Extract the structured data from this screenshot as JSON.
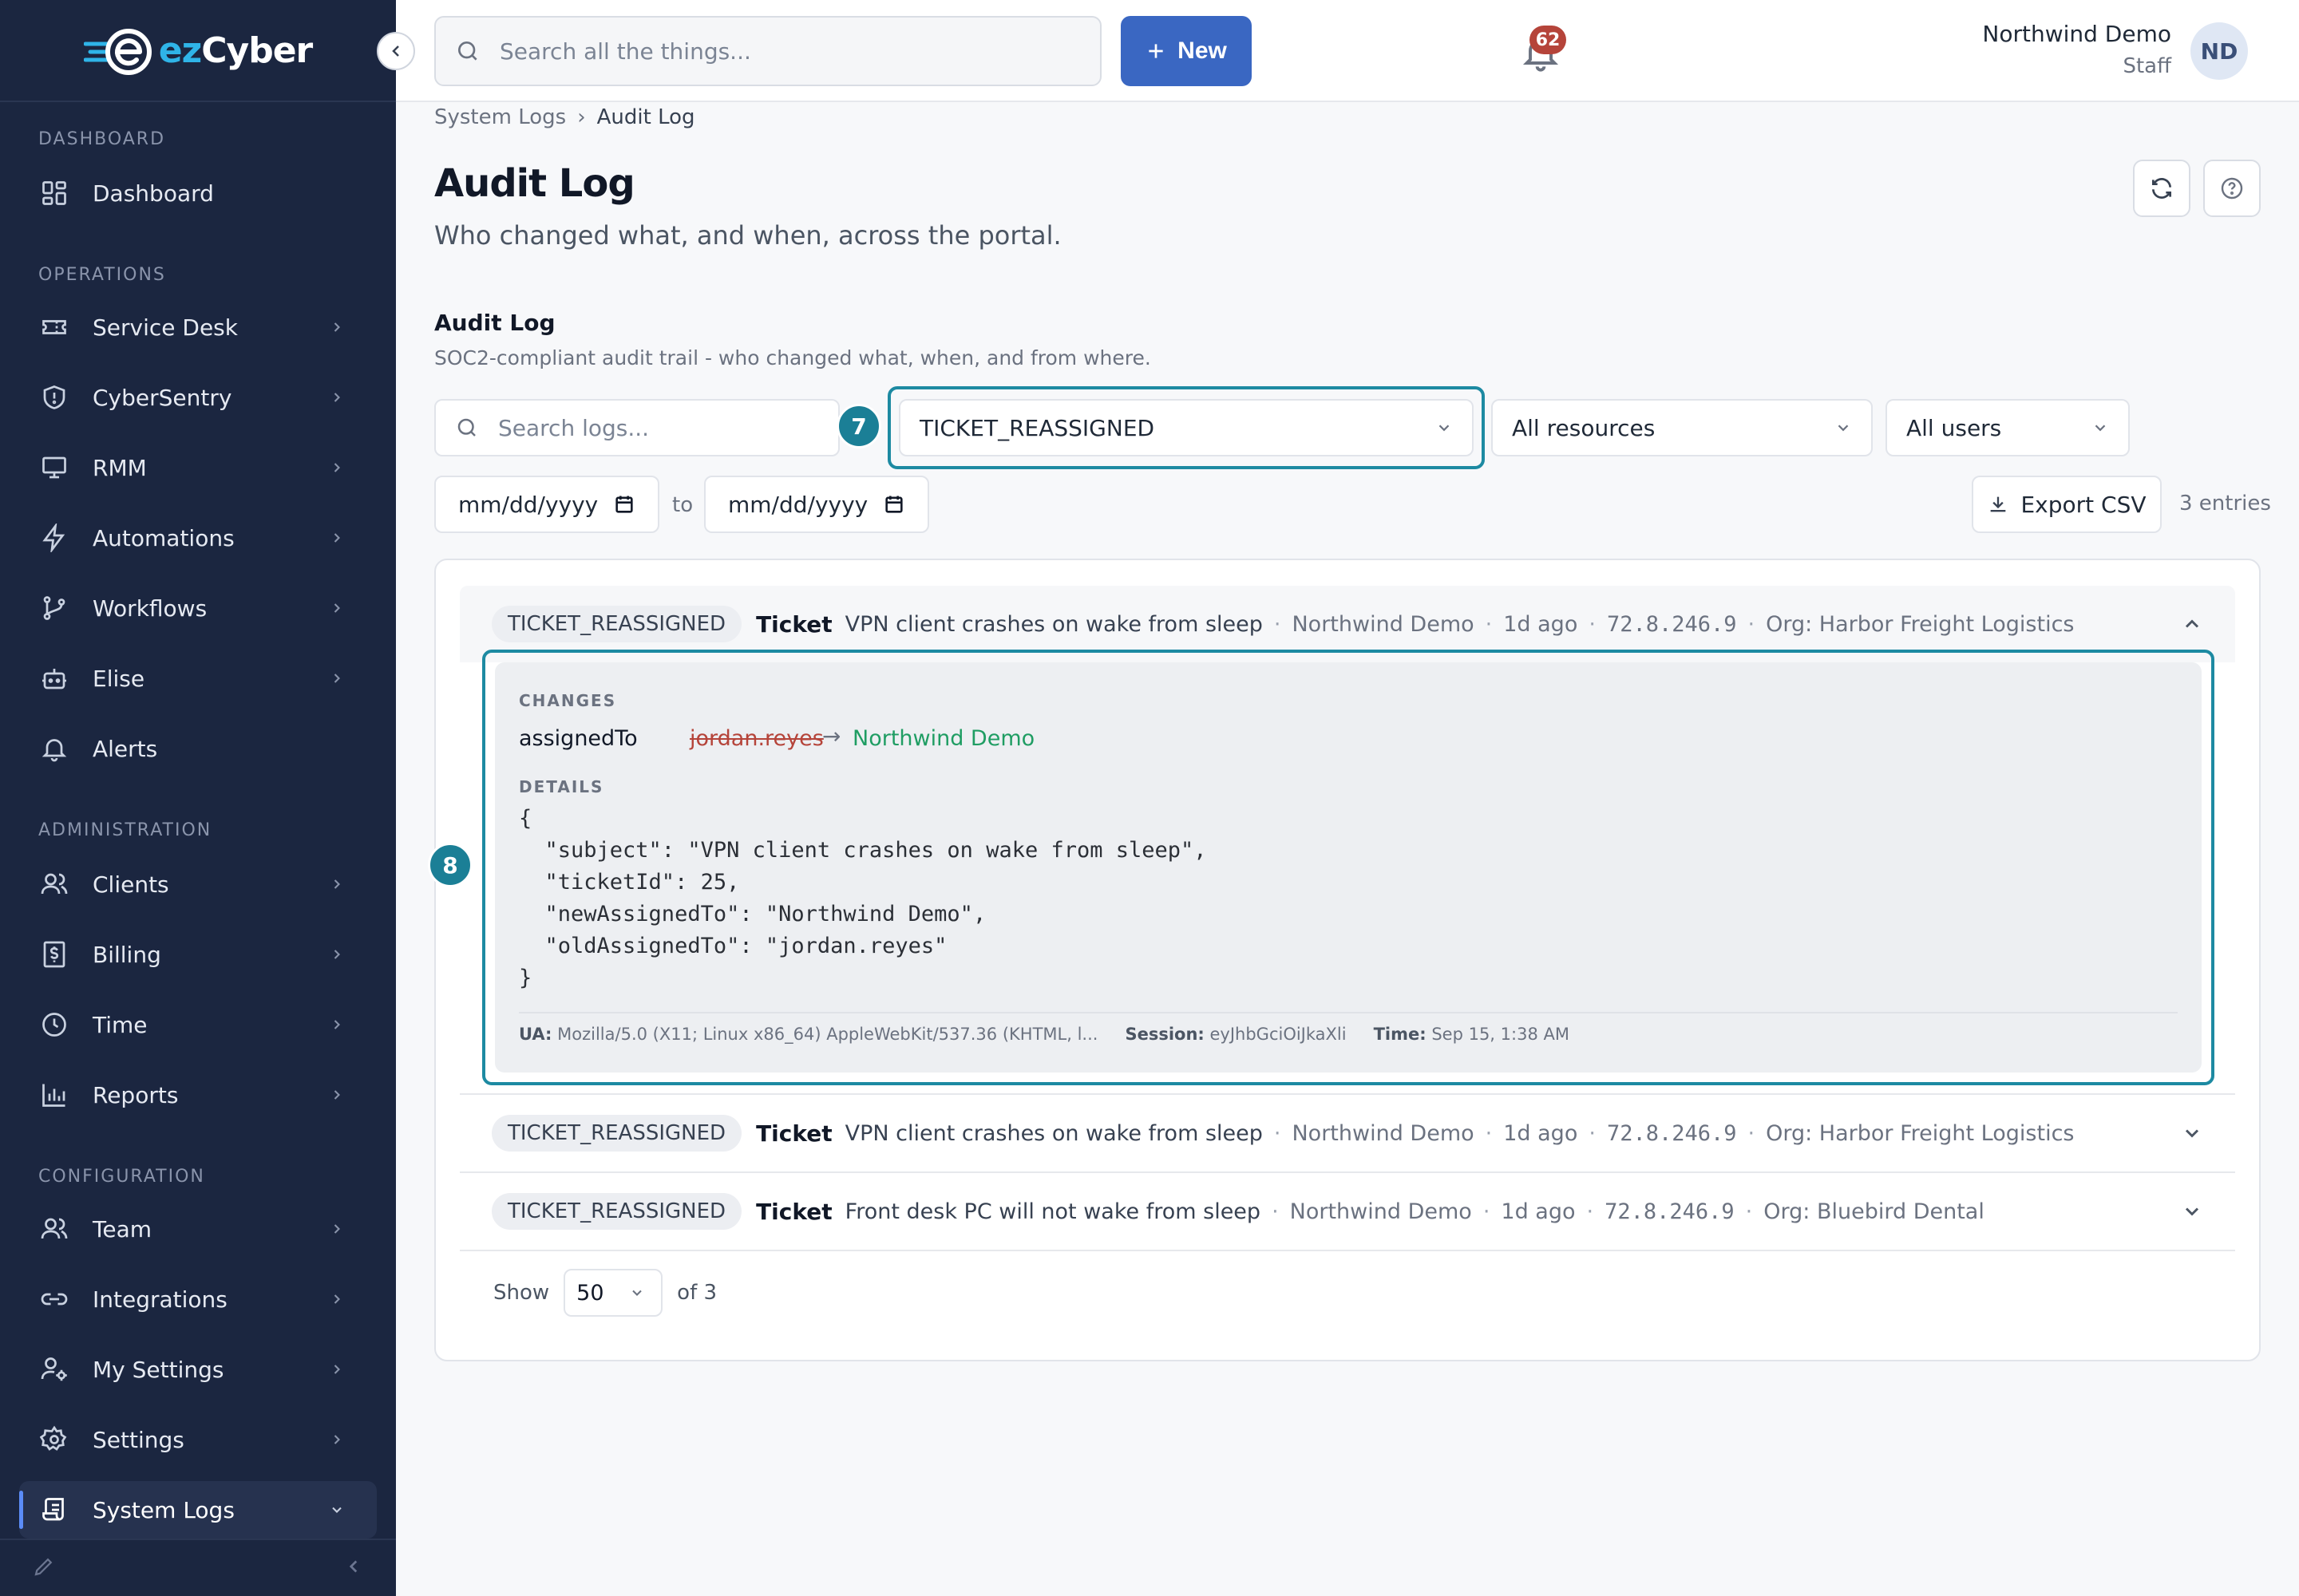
{
  "brand": {
    "name_part1": "ez",
    "name_part2": "Cyber"
  },
  "sidebar": {
    "sections": {
      "dashboard": "DASHBOARD",
      "operations": "OPERATIONS",
      "administration": "ADMINISTRATION",
      "configuration": "CONFIGURATION"
    },
    "items": {
      "dashboard": "Dashboard",
      "service_desk": "Service Desk",
      "cybersentry": "CyberSentry",
      "rmm": "RMM",
      "automations": "Automations",
      "workflows": "Workflows",
      "elise": "Elise",
      "alerts": "Alerts",
      "clients": "Clients",
      "billing": "Billing",
      "time": "Time",
      "reports": "Reports",
      "team": "Team",
      "integrations": "Integrations",
      "my_settings": "My Settings",
      "settings": "Settings",
      "system_logs": "System Logs"
    }
  },
  "topbar": {
    "search_placeholder": "Search all the things...",
    "new_label": "New",
    "notification_count": "62",
    "user_name": "Northwind Demo",
    "user_role": "Staff",
    "avatar_initials": "ND"
  },
  "breadcrumb": {
    "parent": "System Logs",
    "separator": "›",
    "current": "Audit Log"
  },
  "page": {
    "title": "Audit Log",
    "subtitle": "Who changed what, and when, across the portal."
  },
  "audit": {
    "section_title": "Audit Log",
    "section_sub": "SOC2-compliant audit trail - who changed what, when, and from where.",
    "search_placeholder": "Search logs...",
    "action_filter": "TICKET_REASSIGNED",
    "resource_filter": "All resources",
    "user_filter": "All users",
    "date_from": "mm/dd/yyyy",
    "date_to_label": "to",
    "date_to": "mm/dd/yyyy",
    "export_label": "Export CSV",
    "entries_count": "3 entries",
    "step_badges": {
      "filter": "7",
      "details": "8"
    }
  },
  "log_entries": [
    {
      "action": "TICKET_REASSIGNED",
      "resource_type": "Ticket",
      "subject": "VPN client crashes on wake from sleep",
      "actor": "Northwind Demo",
      "when": "1d ago",
      "ip": "72.8.246.9",
      "org": "Org: Harbor Freight Logistics"
    },
    {
      "action": "TICKET_REASSIGNED",
      "resource_type": "Ticket",
      "subject": "VPN client crashes on wake from sleep",
      "actor": "Northwind Demo",
      "when": "1d ago",
      "ip": "72.8.246.9",
      "org": "Org: Harbor Freight Logistics"
    },
    {
      "action": "TICKET_REASSIGNED",
      "resource_type": "Ticket",
      "subject": "Front desk PC will not wake from sleep",
      "actor": "Northwind Demo",
      "when": "1d ago",
      "ip": "72.8.246.9",
      "org": "Org: Bluebird Dental"
    }
  ],
  "detail": {
    "changes_label": "CHANGES",
    "field": "assignedTo",
    "old_value": "jordan.reyes",
    "arrow": "→",
    "new_value": "Northwind Demo",
    "details_label": "DETAILS",
    "json_lines": [
      "{",
      "  \"subject\": \"VPN client crashes on wake from sleep\",",
      "  \"ticketId\": 25,",
      "  \"newAssignedTo\": \"Northwind Demo\",",
      "  \"oldAssignedTo\": \"jordan.reyes\"",
      "}"
    ],
    "ua_label": "UA:",
    "ua_value": "Mozilla/5.0 (X11; Linux x86_64) AppleWebKit/537.36 (KHTML, l...",
    "session_label": "Session:",
    "session_value": "eyJhbGciOiJkaXli",
    "time_label": "Time:",
    "time_value": "Sep 15, 1:38 AM"
  },
  "pager": {
    "show_label": "Show",
    "page_size": "50",
    "of_label": "of 3"
  },
  "colors": {
    "sidebar_bg": "#1b2640",
    "accent": "#3a67c2",
    "highlight": "#1d8aa2",
    "old_value": "#b5443a",
    "new_value": "#1f9d63"
  }
}
